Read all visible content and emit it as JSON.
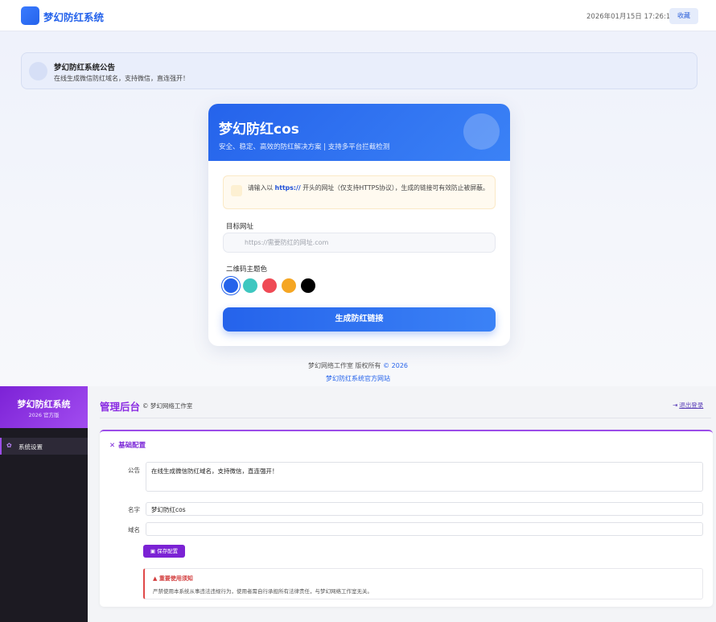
{
  "header": {
    "brand": "梦幻防红系统",
    "datetime": "2026年01月15日 17:26:10",
    "favorite_label": "收藏"
  },
  "notice": {
    "title": "梦幻防红系统公告",
    "text": "在线生成微信防红域名，支持微信，直连强开！"
  },
  "card": {
    "title": "梦幻防红cos",
    "subtitle": "安全、稳定、高效的防红解决方案 | 支持多平台拦截检测",
    "tip_prefix": "请输入以 ",
    "tip_strong": "https://",
    "tip_suffix": " 开头的网址（仅支持HTTPS协议），生成的链接可有效防止被屏蔽。",
    "target_label": "目标网址",
    "url_placeholder": "https://需要防红的网址.com",
    "theme_label": "二维码主题色",
    "theme_colors": [
      "#2563eb",
      "#3ec7c0",
      "#ef4a55",
      "#f5a623",
      "#000000"
    ],
    "selected_color": 0,
    "generate_label": "生成防红链接"
  },
  "footer": {
    "copyright": "梦幻网络工作室 版权所有 ",
    "year": "© 2026",
    "link": "梦幻防红系统官方网站"
  },
  "admin": {
    "sidebar_title": "梦幻防红系统",
    "sidebar_version": "2026 官方版",
    "menu": [
      {
        "label": "系统设置",
        "icon": "gear-icon"
      }
    ],
    "page_title": "管理后台",
    "copyright": "© 梦幻网络工作室",
    "logout_label": "退出登录",
    "panel_title": "基础配置",
    "fields": {
      "notice_label": "公告",
      "notice_value": "在线生成微信防红域名，支持微信，直连强开！",
      "name_label": "名字",
      "name_value": "梦幻防红cos",
      "domain_label": "域名",
      "domain_value": ""
    },
    "save_label": "保存配置",
    "warning_title": "重要使用须知",
    "warning_text": "严禁使用本系统从事违法违规行为，使用者需自行承担所有法律责任，与梦幻网络工作室无关。"
  }
}
